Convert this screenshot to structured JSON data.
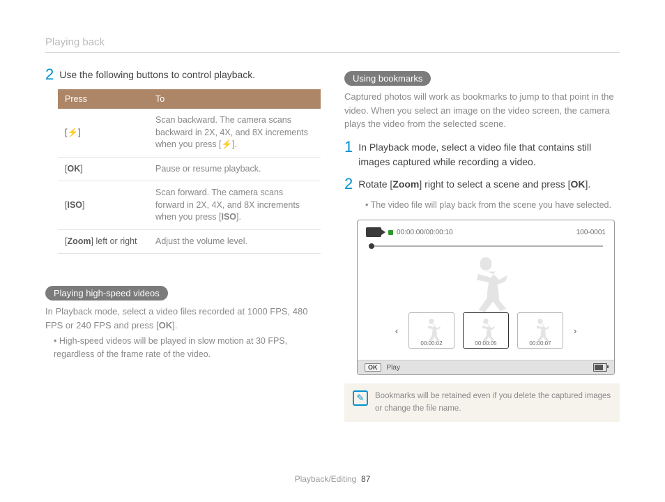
{
  "header": {
    "title": "Playing back"
  },
  "footer": {
    "section": "Playback/Editing",
    "page": "87"
  },
  "left": {
    "step2": {
      "num": "2",
      "text": "Use the following buttons to control playback."
    },
    "table": {
      "th1": "Press",
      "th2": "To",
      "r1c1": "[",
      "r1icon": "⚡",
      "r1c1b": "]",
      "r1c2a": "Scan backward. The camera scans backward in 2X, 4X, and 8X increments when you press [",
      "r1c2b": "].",
      "r2c1a": "[",
      "r2ok": "OK",
      "r2c1b": "]",
      "r2c2": "Pause or resume playback.",
      "r3c1a": "[",
      "r3iso": "ISO",
      "r3c1b": "]",
      "r3c2a": "Scan forward. The camera scans forward in 2X, 4X, and 8X increments when you press [",
      "r3c2b": "].",
      "r4c1a": "[",
      "r4zoom": "Zoom",
      "r4c1b": "] left or right",
      "r4c2": "Adjust the volume level."
    },
    "pill1": "Playing high-speed videos",
    "body1a": "In Playback mode, select a video files recorded at 1000 FPS, 480 FPS or 240 FPS and press [",
    "body1ok": "OK",
    "body1b": "].",
    "bullet1": "High-speed videos will be played in slow motion at 30 FPS, regardless of the frame rate of the video."
  },
  "right": {
    "pill2": "Using bookmarks",
    "body2": "Captured photos will work as bookmarks to jump to that point in the video. When you select an image on the video screen, the camera plays the video from the selected scene.",
    "step1": {
      "num": "1",
      "text": "In Playback mode, select a video file that contains still images captured while recording a video."
    },
    "step2": {
      "num": "2",
      "text_a": "Rotate [",
      "zoom": "Zoom",
      "text_b": "] right to select a scene and press [",
      "ok": "OK",
      "text_c": "]."
    },
    "sub_bullet": "The video file will play back from the scene you have selected.",
    "device": {
      "timecode": "00:00:00/00:00:10",
      "fileno": "100-0001",
      "thumbs": [
        "00:00:02",
        "00:00:05",
        "00:00:07"
      ],
      "arrow_l": "‹",
      "arrow_r": "›",
      "okbtn": "OK",
      "play": "Play"
    },
    "note": "Bookmarks will be retained even if  you delete the captured images or change the file name."
  }
}
